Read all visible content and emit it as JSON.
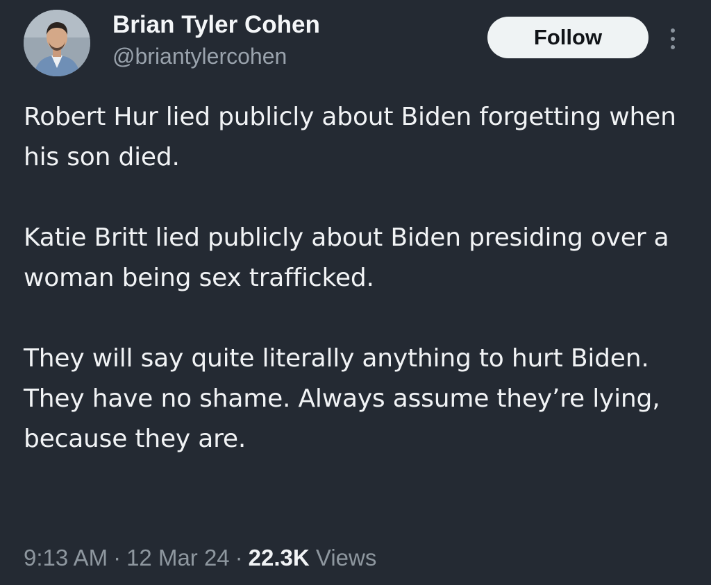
{
  "author": {
    "display_name": "Brian Tyler Cohen",
    "handle": "@briantylercohen",
    "avatar_icon": "profile-photo"
  },
  "actions": {
    "follow_label": "Follow",
    "more_icon": "more-vertical-icon"
  },
  "post": {
    "paragraphs": [
      "Robert Hur lied publicly about Biden forgetting when his son died.",
      "Katie Britt lied publicly about Biden presiding over a woman being sex trafficked.",
      "They will say quite literally anything to hurt Biden. They have no shame. Always assume they’re lying, because they are."
    ]
  },
  "meta": {
    "time": "9:13 AM",
    "separator": "·",
    "date": "12 Mar 24",
    "views_count": "22.3K",
    "views_label": "Views"
  },
  "colors": {
    "background": "#242a33",
    "text": "#f1f3f5",
    "muted": "#8e979f",
    "follow_button": "#eff3f4"
  }
}
